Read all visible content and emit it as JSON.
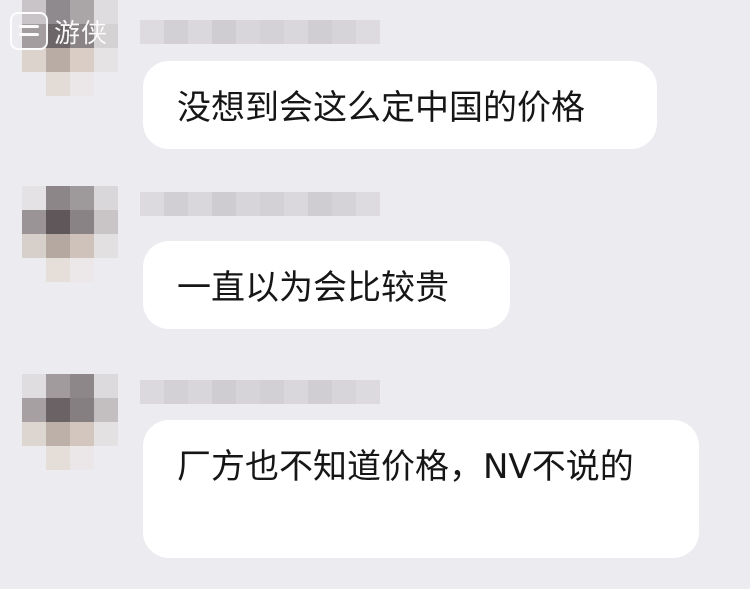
{
  "watermark": {
    "text": "游侠"
  },
  "messages": [
    {
      "text": "没想到会这么定中国的价格"
    },
    {
      "text": "一直以为会比较贵"
    },
    {
      "text": "厂方也不知道价格，NV不说的"
    }
  ],
  "colors": {
    "background": "#ecebf0",
    "bubble": "#ffffff",
    "text": "#161616"
  }
}
